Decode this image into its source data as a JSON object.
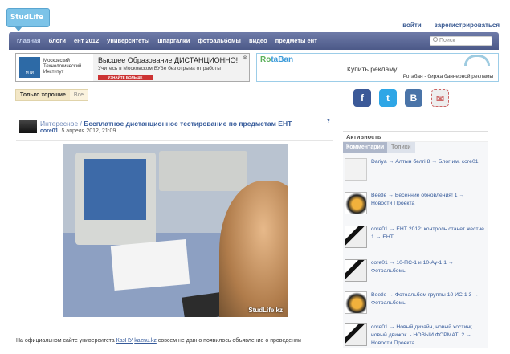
{
  "header": {
    "logo_text": "StudLife",
    "login": "войти",
    "register": "зарегистрироваться"
  },
  "nav": {
    "items": [
      "главная",
      "блоги",
      "ент 2012",
      "университеты",
      "шпаргалки",
      "фотоальбомы",
      "видео",
      "предметы ент"
    ],
    "search_placeholder": "Поиск"
  },
  "banner_left": {
    "org_line1": "Московский",
    "org_line2": "Технологический",
    "org_line3": "Институт",
    "org_abbr": "МТИ",
    "headline": "Высшее Образование ДИСТАНЦИОННО!",
    "subline": "Учитесь в Московском ВУЗе без отрыва от работы",
    "button": "УЗНАЙТЕ БОЛЬШЕ"
  },
  "banner_right": {
    "brand_a": "Ro",
    "brand_b": "taBan",
    "cta": "Купить рекламу",
    "sub": "Ротабан - биржа баннерной рекламы"
  },
  "filter": {
    "active": "Только хорошие",
    "inactive": "Все"
  },
  "social": [
    {
      "name": "facebook",
      "glyph": "f",
      "color": "#3b5998"
    },
    {
      "name": "twitter",
      "glyph": "t",
      "color": "#2ea6e6"
    },
    {
      "name": "vkontakte",
      "glyph": "B",
      "color": "#4a74a8"
    },
    {
      "name": "mail",
      "glyph": "✉",
      "color": "#e6e6e6"
    }
  ],
  "article": {
    "category": "Интересное /",
    "title": "Бесплатное дистанционное тестирование по предметам ЕНТ",
    "author": "core01",
    "date": ", 5 апреля 2012, 21:09",
    "help": "?",
    "watermark": "StudLife.kz",
    "text_before": "На официальном сайте университета ",
    "link1": "КазНУ",
    "link2": "kaznu.kz",
    "text_after": " совсем не давно появилось объявление о проведении"
  },
  "sidebar": {
    "title": "Активность",
    "tab_active": "Комментарии",
    "tab_inactive": "Топики",
    "items": [
      {
        "text": "Dariya → Алтын белгі 8 → Блог им. core01"
      },
      {
        "text": "Beetle → Весенние обновления! 1 → Новости Проекта"
      },
      {
        "text": "core01 → ЕНТ 2012: контроль станет жестче 1 → ЕНТ"
      },
      {
        "text": "core01 → 10-ПС-1 и 10-Ау-1 1 → Фотоальбомы"
      },
      {
        "text": "Beetle → Фотоальбом группы 10 ИС 1 3 → Фотоальбомы"
      },
      {
        "text": "core01 → Новый дизайн, новый хостинг, новый движок. - НОВЫЙ ФОРМАТ! 2 → Новости Проекта"
      }
    ]
  }
}
